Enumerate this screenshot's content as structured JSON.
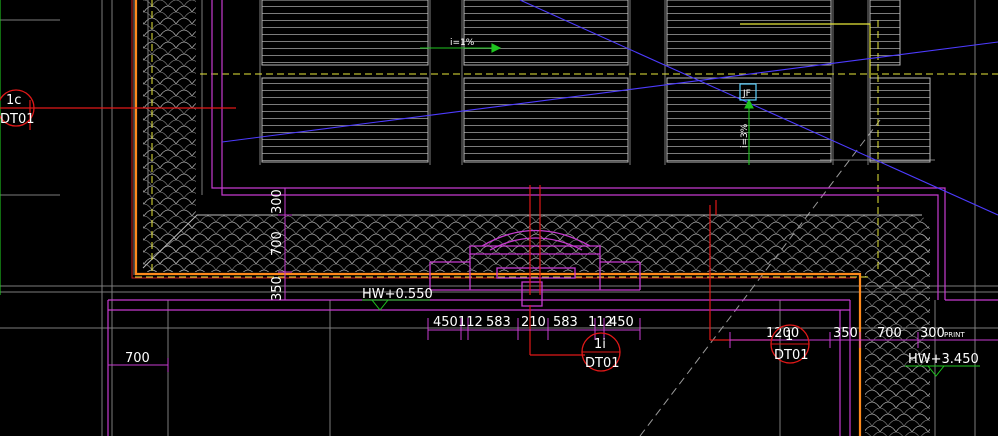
{
  "colors": {
    "background": "#000000",
    "grid": "#7d7d7d",
    "magenta": "#c63bd0",
    "orange": "#ff8a1c",
    "red": "#e01818",
    "blue": "#4d3bff",
    "yellow": "#e8e83a",
    "green": "#1fc51f",
    "white": "#ffffff",
    "cyan": "#5ad0ff"
  },
  "slope_labels": {
    "top": "i=1%",
    "vertical": "i=3%"
  },
  "drain_symbol": "JF",
  "dimensions_vertical": {
    "d1": "300",
    "d2": "700",
    "d3": "350"
  },
  "dimension_left": "700",
  "dimensions_row": {
    "a": "450",
    "b": "112",
    "c": "583",
    "d": "210",
    "e": "583",
    "f": "112",
    "g": "450"
  },
  "dimensions_right": {
    "a": "1200",
    "b": "350",
    "c": "700",
    "d": "300",
    "e": "PRINT"
  },
  "elevations": {
    "left": "HW+0.550",
    "right": "HW+3.450"
  },
  "detail_bubbles": {
    "left": {
      "number": "1c",
      "sheet": "DT01"
    },
    "center": {
      "number": "1i",
      "sheet": "DT01"
    },
    "right": {
      "number": "1",
      "sheet": "DT01"
    }
  }
}
